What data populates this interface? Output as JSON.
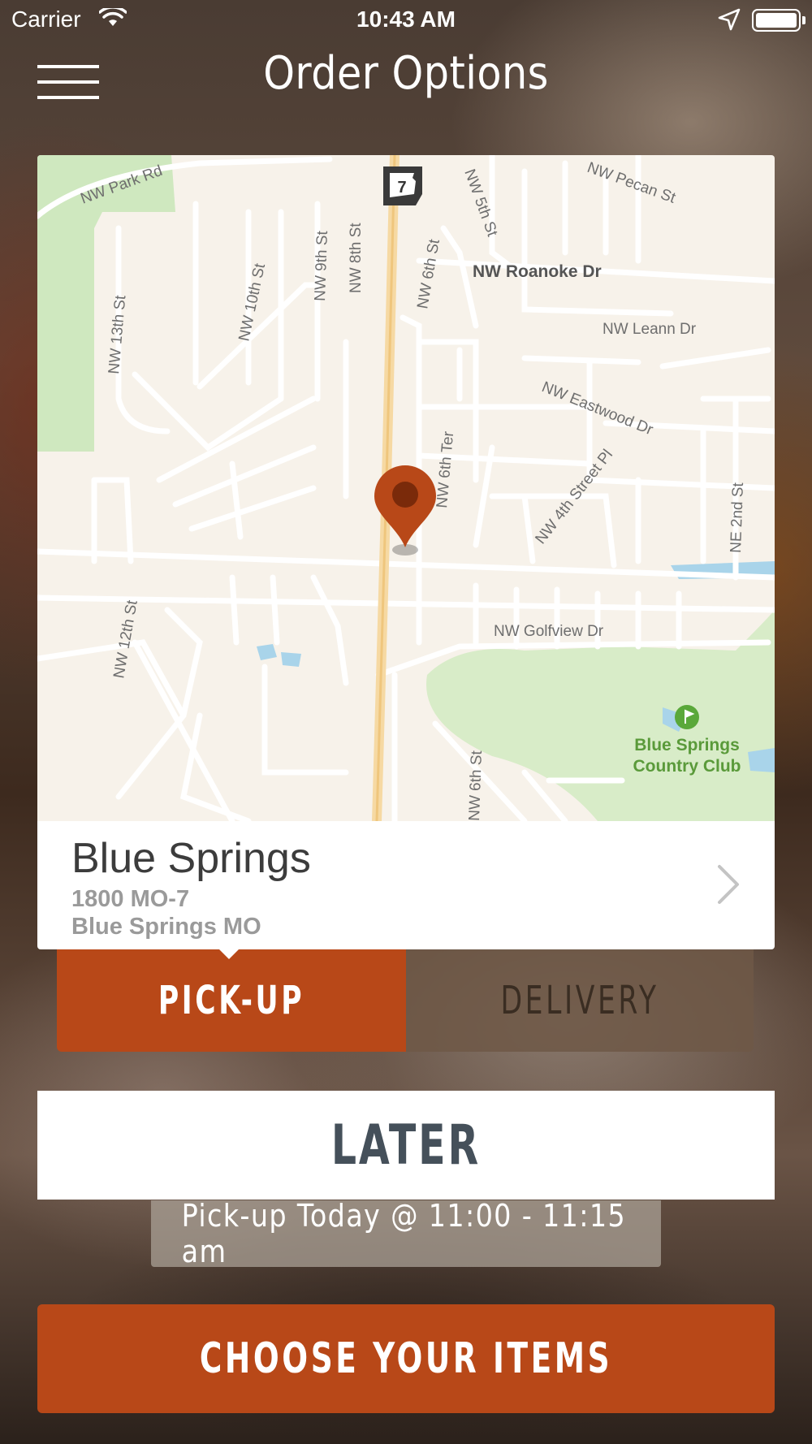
{
  "status_bar": {
    "carrier": "Carrier",
    "time": "10:43 AM"
  },
  "header": {
    "title": "Order Options",
    "menu_icon": "hamburger-menu-icon"
  },
  "map": {
    "pin_color": "#b84818",
    "route_shield": "7",
    "street_labels": {
      "park_rd": "NW Park Rd",
      "pecan": "NW Pecan St",
      "fifth": "NW 5th St",
      "roanoke": "NW Roanoke Dr",
      "sixth_top": "NW 6th St",
      "eighth": "NW 8th St",
      "ninth": "NW 9th St",
      "tenth": "NW 10th St",
      "thirteenth": "NW 13th St",
      "leann": "NW Leann Dr",
      "eastwood": "NW Eastwood Dr",
      "sixth_ter": "NW 6th Ter",
      "fourth_pl": "NW 4th Street Pl",
      "ne_second": "NE 2nd St",
      "golfview": "NW Golfview Dr",
      "twelfth": "NW 12th St",
      "sixth_bottom": "NW 6th St"
    },
    "poi": {
      "line1": "Blue Springs",
      "line2": "Country Club"
    }
  },
  "location": {
    "name": "Blue Springs",
    "address_line1": "1800 MO-7",
    "address_line2": "Blue Springs MO"
  },
  "order_type": {
    "pickup_label": "PICK-UP",
    "delivery_label": "DELIVERY",
    "selected": "pickup"
  },
  "timing": {
    "later_label": "LATER",
    "pickup_time": "Pick-up Today @ 11:00 - 11:15 am"
  },
  "cta": {
    "label": "CHOOSE YOUR ITEMS"
  },
  "colors": {
    "accent": "#b84818",
    "later_text": "#45505a"
  }
}
